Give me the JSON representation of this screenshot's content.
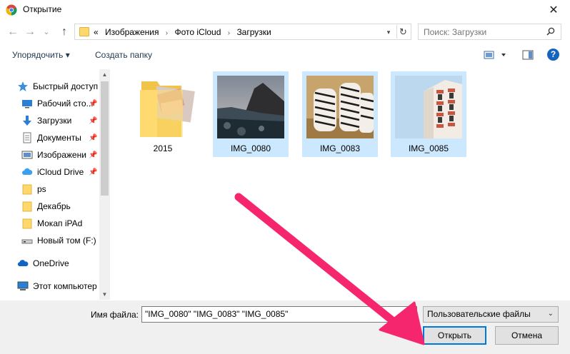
{
  "window": {
    "title": "Открытие",
    "close_glyph": "✕"
  },
  "nav": {
    "back_glyph": "←",
    "forward_glyph": "→",
    "recent_glyph": "⌄",
    "up_glyph": "↑"
  },
  "address": {
    "overflow": "«",
    "crumbs": [
      "Изображения",
      "Фото iCloud",
      "Загрузки"
    ],
    "separator": "›"
  },
  "search": {
    "placeholder": "Поиск: Загрузки"
  },
  "toolbar": {
    "organize_label": "Упорядочить ▾",
    "new_folder_label": "Создать папку",
    "help_glyph": "?"
  },
  "sidebar": {
    "items": [
      {
        "label": "Быстрый доступ",
        "icon": "star-icon"
      },
      {
        "label": "Рабочий сто...",
        "icon": "desktop-icon",
        "pinned": true
      },
      {
        "label": "Загрузки",
        "icon": "download-icon",
        "pinned": true
      },
      {
        "label": "Документы",
        "icon": "document-icon",
        "pinned": true
      },
      {
        "label": "Изображени",
        "icon": "pictures-icon",
        "pinned": true
      },
      {
        "label": "iCloud Drive",
        "icon": "cloud-icon",
        "pinned": true
      },
      {
        "label": "ps",
        "icon": "folder-icon"
      },
      {
        "label": "Декабрь",
        "icon": "folder-icon"
      },
      {
        "label": "Мокап iPAd",
        "icon": "folder-icon"
      },
      {
        "label": "Новый том (F:)",
        "icon": "drive-icon"
      },
      {
        "label": "OneDrive",
        "icon": "onedrive-icon"
      },
      {
        "label": "Этот компьютер",
        "icon": "computer-icon"
      }
    ],
    "pin_glyph": "📌"
  },
  "files": [
    {
      "name": "2015",
      "type": "folder",
      "selected": false
    },
    {
      "name": "IMG_0080",
      "type": "image",
      "selected": true
    },
    {
      "name": "IMG_0083",
      "type": "image",
      "selected": true
    },
    {
      "name": "IMG_0085",
      "type": "image",
      "selected": true
    }
  ],
  "bottom": {
    "filename_label": "Имя файла:",
    "filename_value": "\"IMG_0080\" \"IMG_0083\" \"IMG_0085\"",
    "filetype_value": "Пользовательские файлы",
    "open_label": "Открыть",
    "cancel_label": "Отмена"
  },
  "colors": {
    "selection": "#cce8ff",
    "accent": "#0078d7",
    "arrow": "#f5266e"
  }
}
